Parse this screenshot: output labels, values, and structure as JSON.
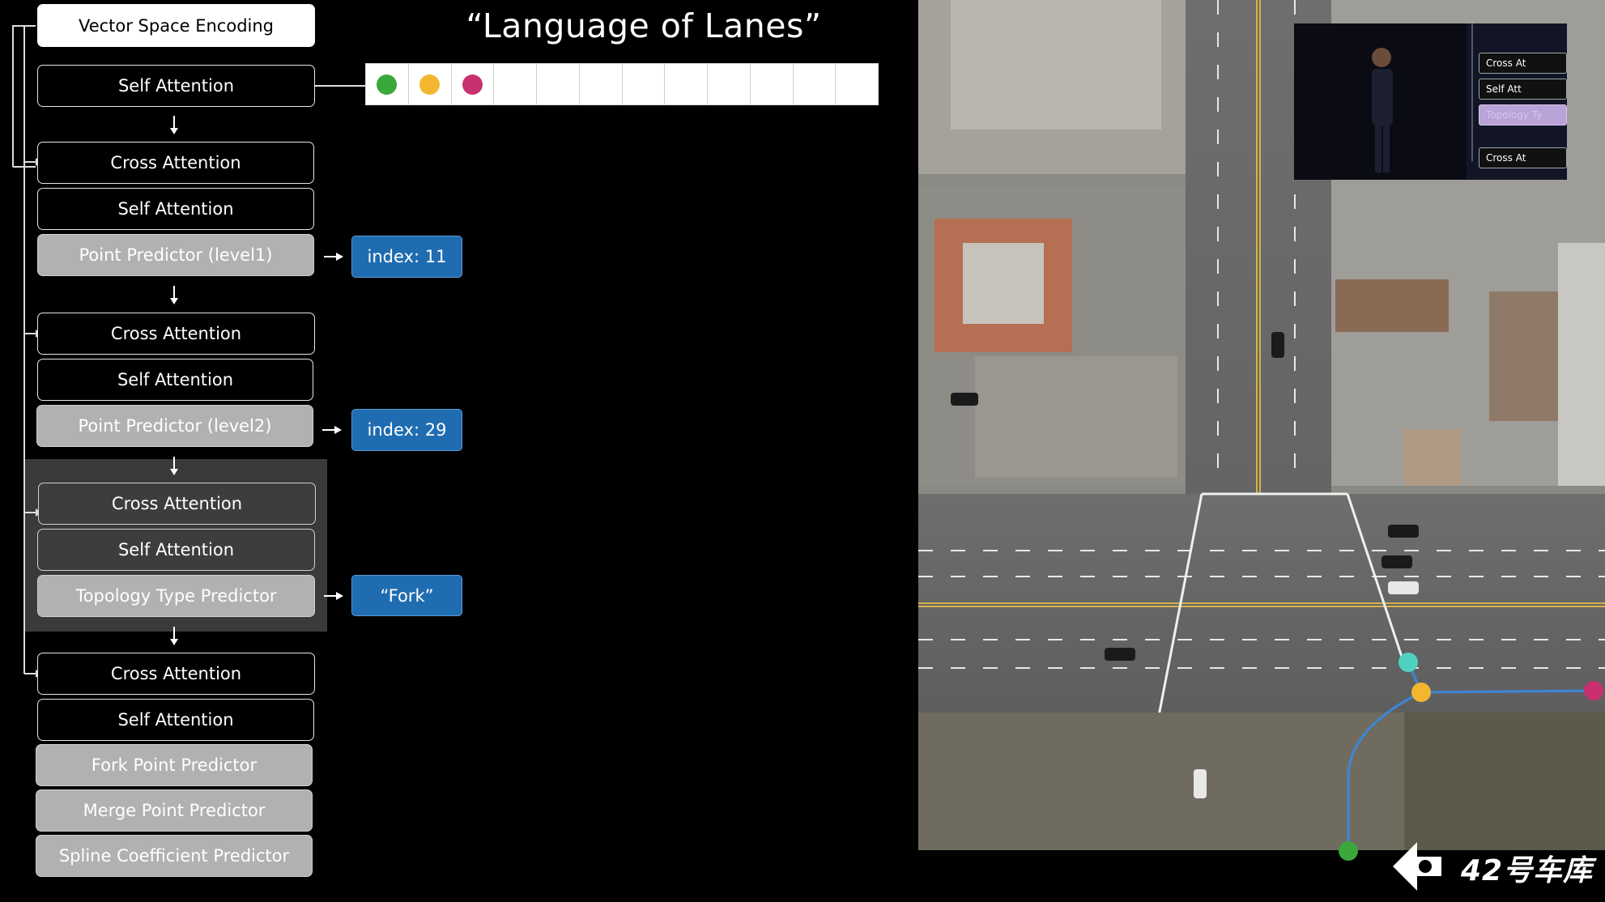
{
  "title": "“Language of Lanes”",
  "blocks": {
    "vse": "Vector Space Encoding",
    "sa0": "Self Attention",
    "ca1": "Cross Attention",
    "sa1": "Self Attention",
    "pp1": "Point Predictor (level1)",
    "ca2": "Cross Attention",
    "sa2": "Self Attention",
    "pp2": "Point Predictor (level2)",
    "ca3": "Cross Attention",
    "sa3": "Self Attention",
    "tp": "Topology Type Predictor",
    "ca4": "Cross Attention",
    "sa4": "Self Attention",
    "fork": "Fork Point Predictor",
    "merge": "Merge Point Predictor",
    "spline": "Spline Coefficient Predictor"
  },
  "outputs": {
    "index1": "index: 11",
    "index2": "index: 29",
    "topology": "“Fork”"
  },
  "token_strip": {
    "cells": 12,
    "dot_colors": [
      "#3aa83a",
      "#f2b630",
      "#c9306f"
    ]
  },
  "inset": {
    "labels": [
      "Cross At",
      "Self Att",
      "Topology Ty",
      "Cross At"
    ]
  },
  "watermark": "42号车库",
  "colors": {
    "output_blue": "#1f6cb1",
    "lane_line": "#3a87d8",
    "node_teal": "#4fd1c0",
    "node_yellow": "#f2b630",
    "node_green": "#3aa83a",
    "node_magenta": "#c9306f"
  }
}
